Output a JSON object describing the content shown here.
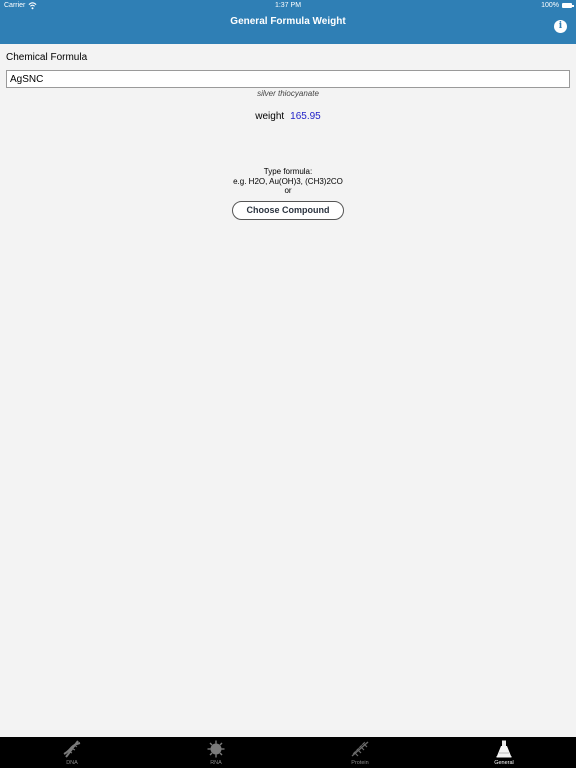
{
  "status_bar": {
    "carrier": "Carrier",
    "time": "1:37 PM",
    "battery": "100%"
  },
  "nav": {
    "title": "General Formula Weight",
    "info_icon": "info-icon"
  },
  "form": {
    "label": "Chemical Formula",
    "formula_value": "AgSNC",
    "compound_name": "silver thiocyanate",
    "weight_label": "weight",
    "weight_value": "165.95"
  },
  "hint": {
    "line1": "Type formula:",
    "line2": "e.g. H2O, Au(OH)3, (CH3)2CO",
    "line3": "or"
  },
  "choose_button": "Choose Compound",
  "tabs": [
    {
      "label": "DNA",
      "icon": "dna-icon",
      "active": false
    },
    {
      "label": "RNA",
      "icon": "rna-icon",
      "active": false
    },
    {
      "label": "Protein",
      "icon": "protein-icon",
      "active": false
    },
    {
      "label": "General",
      "icon": "flask-icon",
      "active": true
    }
  ],
  "colors": {
    "nav_background": "#2f7fb5",
    "weight_value": "#1f1fc8",
    "page_background": "#f3f3f3"
  }
}
